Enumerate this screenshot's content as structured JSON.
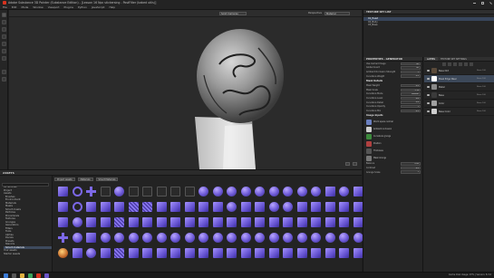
{
  "app": {
    "title": "Adobe Substance 3D Painter (Substance Edition) - [Lesson 16 Npc stickersing - PostFilter (baked utils)]",
    "menu": [
      "File",
      "Edit",
      "Mode",
      "Window",
      "Viewport",
      "Plugins",
      "Python",
      "JavaScript",
      "Help"
    ]
  },
  "viewport": {
    "channel": "Material",
    "display_mode": "Solid Cameras",
    "shading": "Perspective"
  },
  "shelf": {
    "title": "ASSETS",
    "filters": [
      "Project assets",
      "Materials",
      "Smart Materials"
    ],
    "tree": [
      "All libraries",
      "Project",
      "Assets",
      "Brushes",
      "Environment",
      "Materials",
      "Masks",
      "Smart masks",
      "Particles",
      "Procedurals",
      "Textures",
      "Grunges",
      "Generators",
      "Filters",
      "Tools",
      "Alphas",
      "Decals",
      "Presets",
      "Stencils",
      "Smart materials",
      "Your assets",
      "Starter assets"
    ],
    "tree_selected": 19
  },
  "texture_set": {
    "title": "TEXTURE SET LIST",
    "rows": [
      "01_Head",
      "02_Body",
      "03_Base"
    ],
    "selected": 0
  },
  "properties": {
    "title": "PROPERTIES - GENERATOR",
    "fields": [
      {
        "label": "Use Cached Image",
        "value": "Off"
      },
      {
        "label": "Global Invert",
        "value": "Off"
      },
      {
        "label": "Ambient Occlusion Strength",
        "value": "1"
      },
      {
        "label": "Curvature Weight",
        "value": "0.5"
      }
    ],
    "section_local": "Mask Details",
    "local_fields": [
      {
        "label": "Mask Weight",
        "value": "0.5"
      },
      {
        "label": "Mask Scale",
        "value": "1.19"
      },
      {
        "label": "Curvature Mode",
        "value": "Smooth"
      },
      {
        "label": "Curvature Level",
        "value": "0.6"
      },
      {
        "label": "Curvature Detail",
        "value": "0.4"
      },
      {
        "label": "Curvature Opacity",
        "value": "1"
      },
      {
        "label": "Curvature Min",
        "value": "0.2"
      }
    ],
    "section_image": "Image inputs",
    "materials": [
      {
        "name": "World space normal",
        "sub": "Base_normal_world_space",
        "color": "#6a7fbf"
      },
      {
        "name": "Ambient occlusion",
        "sub": "Base_ambient_occlusion",
        "color": "#cfcfcf"
      },
      {
        "name": "Curvature grunge",
        "sub": "Grunge_map",
        "color": "#3c8a3c"
      },
      {
        "name": "Position",
        "sub": "Base_position",
        "color": "#b04040"
      },
      {
        "name": "Thickness",
        "sub": "Base_thickness",
        "color": "#555555"
      },
      {
        "name": "Mask Grunge",
        "sub": "Grunge_concrete",
        "color": "#777777"
      }
    ],
    "bottom_fields": [
      {
        "label": "Balance",
        "value": "0.49"
      },
      {
        "label": "Contrast",
        "value": "0.5"
      },
      {
        "label": "Grunge Scale",
        "value": "1"
      }
    ]
  },
  "layers": {
    "tabs": [
      "LAYERS",
      "TEXTURE SET SETTINGS"
    ],
    "active_tab": 0,
    "items": [
      {
        "name": "Base Dirt",
        "blend": "Norm 100",
        "color": "#5a4a3a"
      },
      {
        "name": "Mask Edge Wear",
        "blend": "Norm 100",
        "color": "#ffffff",
        "selected": true
      },
      {
        "name": "Metal",
        "blend": "Norm 100",
        "color": "#888888"
      },
      {
        "name": "Base",
        "blend": "Norm 100",
        "color": "#3a3a3a"
      },
      {
        "name": "Color",
        "blend": "Norm 100",
        "color": "#a0a0a0"
      },
      {
        "name": "Base Color",
        "blend": "Norm 100",
        "color": "#cfcfcf"
      }
    ]
  },
  "status": {
    "right": "Cache Disk Usage: 97% | Version: 8.3.0"
  },
  "colors": {
    "accent": "#6d8ec9",
    "selection": "#3c4859",
    "brand": "#d8321e"
  }
}
